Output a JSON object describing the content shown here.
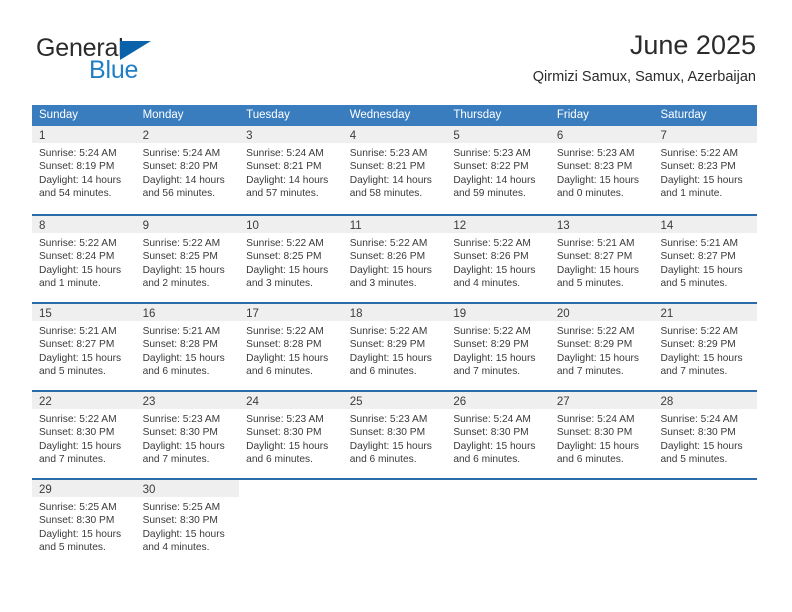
{
  "brand": {
    "name_part1": "General",
    "name_part2": "Blue",
    "logo_icon": "triangle-flag-icon",
    "accent_color": "#0a62ab",
    "blue_text_color": "#1f7fc4"
  },
  "header": {
    "title": "June 2025",
    "subtitle": "Qirmizi Samux, Samux, Azerbaijan"
  },
  "calendar": {
    "header_bg": "#3a7dbf",
    "divider_color": "#2c6cab",
    "day_band_bg": "#efefef",
    "weekdays": [
      "Sunday",
      "Monday",
      "Tuesday",
      "Wednesday",
      "Thursday",
      "Friday",
      "Saturday"
    ],
    "weeks": [
      {
        "days": [
          {
            "num": "1",
            "sunrise": "Sunrise: 5:24 AM",
            "sunset": "Sunset: 8:19 PM",
            "daylight_line1": "Daylight: 14 hours",
            "daylight_line2": "and 54 minutes."
          },
          {
            "num": "2",
            "sunrise": "Sunrise: 5:24 AM",
            "sunset": "Sunset: 8:20 PM",
            "daylight_line1": "Daylight: 14 hours",
            "daylight_line2": "and 56 minutes."
          },
          {
            "num": "3",
            "sunrise": "Sunrise: 5:24 AM",
            "sunset": "Sunset: 8:21 PM",
            "daylight_line1": "Daylight: 14 hours",
            "daylight_line2": "and 57 minutes."
          },
          {
            "num": "4",
            "sunrise": "Sunrise: 5:23 AM",
            "sunset": "Sunset: 8:21 PM",
            "daylight_line1": "Daylight: 14 hours",
            "daylight_line2": "and 58 minutes."
          },
          {
            "num": "5",
            "sunrise": "Sunrise: 5:23 AM",
            "sunset": "Sunset: 8:22 PM",
            "daylight_line1": "Daylight: 14 hours",
            "daylight_line2": "and 59 minutes."
          },
          {
            "num": "6",
            "sunrise": "Sunrise: 5:23 AM",
            "sunset": "Sunset: 8:23 PM",
            "daylight_line1": "Daylight: 15 hours",
            "daylight_line2": "and 0 minutes."
          },
          {
            "num": "7",
            "sunrise": "Sunrise: 5:22 AM",
            "sunset": "Sunset: 8:23 PM",
            "daylight_line1": "Daylight: 15 hours",
            "daylight_line2": "and 1 minute."
          }
        ]
      },
      {
        "days": [
          {
            "num": "8",
            "sunrise": "Sunrise: 5:22 AM",
            "sunset": "Sunset: 8:24 PM",
            "daylight_line1": "Daylight: 15 hours",
            "daylight_line2": "and 1 minute."
          },
          {
            "num": "9",
            "sunrise": "Sunrise: 5:22 AM",
            "sunset": "Sunset: 8:25 PM",
            "daylight_line1": "Daylight: 15 hours",
            "daylight_line2": "and 2 minutes."
          },
          {
            "num": "10",
            "sunrise": "Sunrise: 5:22 AM",
            "sunset": "Sunset: 8:25 PM",
            "daylight_line1": "Daylight: 15 hours",
            "daylight_line2": "and 3 minutes."
          },
          {
            "num": "11",
            "sunrise": "Sunrise: 5:22 AM",
            "sunset": "Sunset: 8:26 PM",
            "daylight_line1": "Daylight: 15 hours",
            "daylight_line2": "and 3 minutes."
          },
          {
            "num": "12",
            "sunrise": "Sunrise: 5:22 AM",
            "sunset": "Sunset: 8:26 PM",
            "daylight_line1": "Daylight: 15 hours",
            "daylight_line2": "and 4 minutes."
          },
          {
            "num": "13",
            "sunrise": "Sunrise: 5:21 AM",
            "sunset": "Sunset: 8:27 PM",
            "daylight_line1": "Daylight: 15 hours",
            "daylight_line2": "and 5 minutes."
          },
          {
            "num": "14",
            "sunrise": "Sunrise: 5:21 AM",
            "sunset": "Sunset: 8:27 PM",
            "daylight_line1": "Daylight: 15 hours",
            "daylight_line2": "and 5 minutes."
          }
        ]
      },
      {
        "days": [
          {
            "num": "15",
            "sunrise": "Sunrise: 5:21 AM",
            "sunset": "Sunset: 8:27 PM",
            "daylight_line1": "Daylight: 15 hours",
            "daylight_line2": "and 5 minutes."
          },
          {
            "num": "16",
            "sunrise": "Sunrise: 5:21 AM",
            "sunset": "Sunset: 8:28 PM",
            "daylight_line1": "Daylight: 15 hours",
            "daylight_line2": "and 6 minutes."
          },
          {
            "num": "17",
            "sunrise": "Sunrise: 5:22 AM",
            "sunset": "Sunset: 8:28 PM",
            "daylight_line1": "Daylight: 15 hours",
            "daylight_line2": "and 6 minutes."
          },
          {
            "num": "18",
            "sunrise": "Sunrise: 5:22 AM",
            "sunset": "Sunset: 8:29 PM",
            "daylight_line1": "Daylight: 15 hours",
            "daylight_line2": "and 6 minutes."
          },
          {
            "num": "19",
            "sunrise": "Sunrise: 5:22 AM",
            "sunset": "Sunset: 8:29 PM",
            "daylight_line1": "Daylight: 15 hours",
            "daylight_line2": "and 7 minutes."
          },
          {
            "num": "20",
            "sunrise": "Sunrise: 5:22 AM",
            "sunset": "Sunset: 8:29 PM",
            "daylight_line1": "Daylight: 15 hours",
            "daylight_line2": "and 7 minutes."
          },
          {
            "num": "21",
            "sunrise": "Sunrise: 5:22 AM",
            "sunset": "Sunset: 8:29 PM",
            "daylight_line1": "Daylight: 15 hours",
            "daylight_line2": "and 7 minutes."
          }
        ]
      },
      {
        "days": [
          {
            "num": "22",
            "sunrise": "Sunrise: 5:22 AM",
            "sunset": "Sunset: 8:30 PM",
            "daylight_line1": "Daylight: 15 hours",
            "daylight_line2": "and 7 minutes."
          },
          {
            "num": "23",
            "sunrise": "Sunrise: 5:23 AM",
            "sunset": "Sunset: 8:30 PM",
            "daylight_line1": "Daylight: 15 hours",
            "daylight_line2": "and 7 minutes."
          },
          {
            "num": "24",
            "sunrise": "Sunrise: 5:23 AM",
            "sunset": "Sunset: 8:30 PM",
            "daylight_line1": "Daylight: 15 hours",
            "daylight_line2": "and 6 minutes."
          },
          {
            "num": "25",
            "sunrise": "Sunrise: 5:23 AM",
            "sunset": "Sunset: 8:30 PM",
            "daylight_line1": "Daylight: 15 hours",
            "daylight_line2": "and 6 minutes."
          },
          {
            "num": "26",
            "sunrise": "Sunrise: 5:24 AM",
            "sunset": "Sunset: 8:30 PM",
            "daylight_line1": "Daylight: 15 hours",
            "daylight_line2": "and 6 minutes."
          },
          {
            "num": "27",
            "sunrise": "Sunrise: 5:24 AM",
            "sunset": "Sunset: 8:30 PM",
            "daylight_line1": "Daylight: 15 hours",
            "daylight_line2": "and 6 minutes."
          },
          {
            "num": "28",
            "sunrise": "Sunrise: 5:24 AM",
            "sunset": "Sunset: 8:30 PM",
            "daylight_line1": "Daylight: 15 hours",
            "daylight_line2": "and 5 minutes."
          }
        ]
      },
      {
        "days": [
          {
            "num": "29",
            "sunrise": "Sunrise: 5:25 AM",
            "sunset": "Sunset: 8:30 PM",
            "daylight_line1": "Daylight: 15 hours",
            "daylight_line2": "and 5 minutes."
          },
          {
            "num": "30",
            "sunrise": "Sunrise: 5:25 AM",
            "sunset": "Sunset: 8:30 PM",
            "daylight_line1": "Daylight: 15 hours",
            "daylight_line2": "and 4 minutes."
          },
          {
            "num": "",
            "empty": true
          },
          {
            "num": "",
            "empty": true
          },
          {
            "num": "",
            "empty": true
          },
          {
            "num": "",
            "empty": true
          },
          {
            "num": "",
            "empty": true
          }
        ]
      }
    ]
  }
}
